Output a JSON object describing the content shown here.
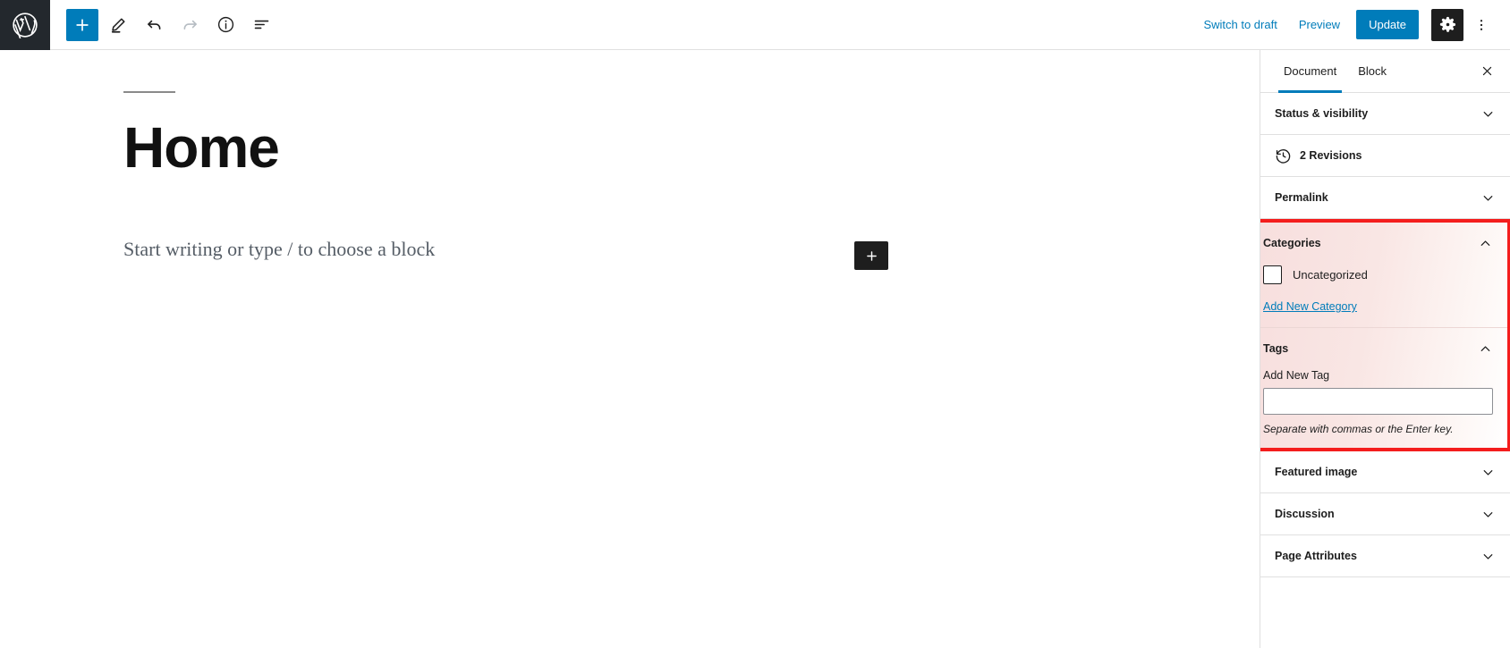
{
  "toolbar": {
    "logo_icon": "wordpress-logo-icon",
    "add_block_label": "+",
    "add_block_icon": "plus-icon",
    "edit_icon": "pencil-icon",
    "undo_icon": "undo-icon",
    "redo_icon": "redo-icon",
    "info_icon": "info-icon",
    "list_view_icon": "list-view-icon",
    "switch_to_draft": "Switch to draft",
    "preview": "Preview",
    "update": "Update",
    "settings_icon": "gear-icon",
    "more_icon": "kebab-menu-icon"
  },
  "editor": {
    "post_title": "Home",
    "block_placeholder": "Start writing or type / to choose a block",
    "appender_label": "+"
  },
  "sidebar": {
    "tabs": [
      {
        "label": "Document",
        "active": true
      },
      {
        "label": "Block",
        "active": false
      }
    ],
    "close_icon": "close-icon",
    "panels": [
      {
        "label": "Status & visibility",
        "state": "collapsed"
      },
      {
        "label": "Permalink",
        "state": "collapsed"
      },
      {
        "label": "Featured image",
        "state": "collapsed"
      },
      {
        "label": "Discussion",
        "state": "collapsed"
      },
      {
        "label": "Page Attributes",
        "state": "collapsed"
      }
    ],
    "revisions": {
      "label": "2 Revisions",
      "icon": "revisions-clock-icon"
    },
    "categories": {
      "label": "Categories",
      "state": "expanded",
      "items": [
        {
          "label": "Uncategorized",
          "checked": false
        }
      ],
      "add_new_link": "Add New Category"
    },
    "tags": {
      "label": "Tags",
      "state": "expanded",
      "field_label": "Add New Tag",
      "input_value": "",
      "input_placeholder": "",
      "help_text": "Separate with commas or the Enter key."
    }
  },
  "highlight": {
    "border_color": "#f41d1d",
    "tint_color": "#f7dedd"
  },
  "colors": {
    "accent": "#007cba",
    "dark": "#1e1e1e",
    "logo_bg": "#23282d"
  }
}
